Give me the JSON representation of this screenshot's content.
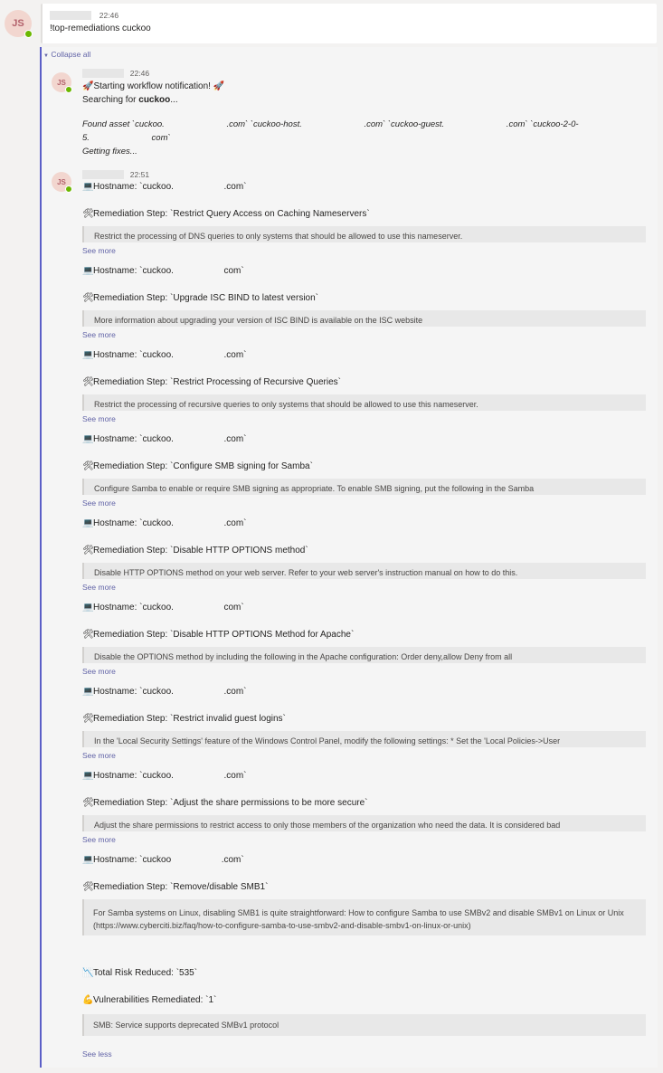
{
  "top_message": {
    "time": "22:46",
    "text": "!top-remediations cuckoo"
  },
  "collapse_label": "Collapse all",
  "avatar_initials": "JS",
  "reply1": {
    "time": "22:46",
    "line1": "🚀Starting workflow notification! 🚀",
    "searching_prefix": "Searching for ",
    "searching_term": "cuckoo",
    "searching_suffix": "...",
    "found_line1": "Found asset `cuckoo.                          .com` `cuckoo-host.                          .com` `cuckoo-guest.                          .com` `cuckoo-2-0-",
    "found_line2": "5.                          com`",
    "getting_fixes": "Getting fixes..."
  },
  "reply2": {
    "time": "22:51",
    "steps": [
      {
        "host": "Hostname: `cuckoo.                    .com`",
        "step": "Remediation Step: `Restrict Query Access on Caching Nameservers`",
        "detail": "Restrict the processing of DNS queries to only systems that should be allowed to use this nameserver.",
        "see_more": "See more"
      },
      {
        "host": "Hostname: `cuckoo.                    com`",
        "step": "Remediation Step: `Upgrade ISC BIND to latest version`",
        "detail": "More information about upgrading your version of ISC BIND is available on the ISC website",
        "see_more": "See more"
      },
      {
        "host": "Hostname: `cuckoo.                    .com`",
        "step": "Remediation Step: `Restrict Processing of Recursive Queries`",
        "detail": "Restrict the processing of recursive queries to only systems that should be allowed to use this nameserver.",
        "see_more": "See more"
      },
      {
        "host": "Hostname: `cuckoo.                    .com`",
        "step": "Remediation Step: `Configure SMB signing for Samba`",
        "detail": "Configure Samba to enable or require SMB signing as appropriate. To enable SMB signing, put the following in the Samba",
        "see_more": "See more"
      },
      {
        "host": "Hostname: `cuckoo.                    .com`",
        "step": "Remediation Step: `Disable HTTP OPTIONS method`",
        "detail": "Disable HTTP OPTIONS method on your web server. Refer to your web server's instruction manual on how to do this.",
        "see_more": "See more"
      },
      {
        "host": "Hostname: `cuckoo.                    com`",
        "step": "Remediation Step: `Disable HTTP OPTIONS Method for Apache`",
        "detail": "Disable the OPTIONS method by including the following in the Apache configuration: Order deny,allow Deny from all",
        "see_more": "See more"
      },
      {
        "host": "Hostname: `cuckoo.                    .com`",
        "step": "Remediation Step: `Restrict invalid guest logins`",
        "detail": "In the 'Local Security Settings' feature of the Windows Control Panel, modify the following settings: * Set the 'Local Policies->User",
        "see_more": "See more"
      },
      {
        "host": "Hostname: `cuckoo.                    .com`",
        "step": "Remediation Step: `Adjust the share permissions to be more secure`",
        "detail": "Adjust the share permissions to restrict access to only those members of the organization who need the data. It is considered bad",
        "see_more": "See more"
      },
      {
        "host": "Hostname: `cuckoo                    .com`",
        "step": "Remediation Step: `Remove/disable SMB1`",
        "detail": "For Samba systems on Linux, disabling SMB1 is quite straightforward: How to configure Samba to use SMBv2 and disable SMBv1 on Linux or Unix (https://www.cyberciti.biz/faq/how-to-configure-samba-to-use-smbv2-and-disable-smbv1-on-linux-or-unix)",
        "see_more": ""
      }
    ],
    "total_risk": "Total Risk Reduced: `535`",
    "vulns": "Vulnerabilities Remediated: `1`",
    "vuln_detail": "SMB: Service supports deprecated SMBv1 protocol",
    "see_less": "See less"
  },
  "colors": {
    "accent": "#6264a7",
    "thread_bar": "#5b5fc7",
    "presence": "#6bb700",
    "avatar_bg": "#f2d6cf"
  }
}
